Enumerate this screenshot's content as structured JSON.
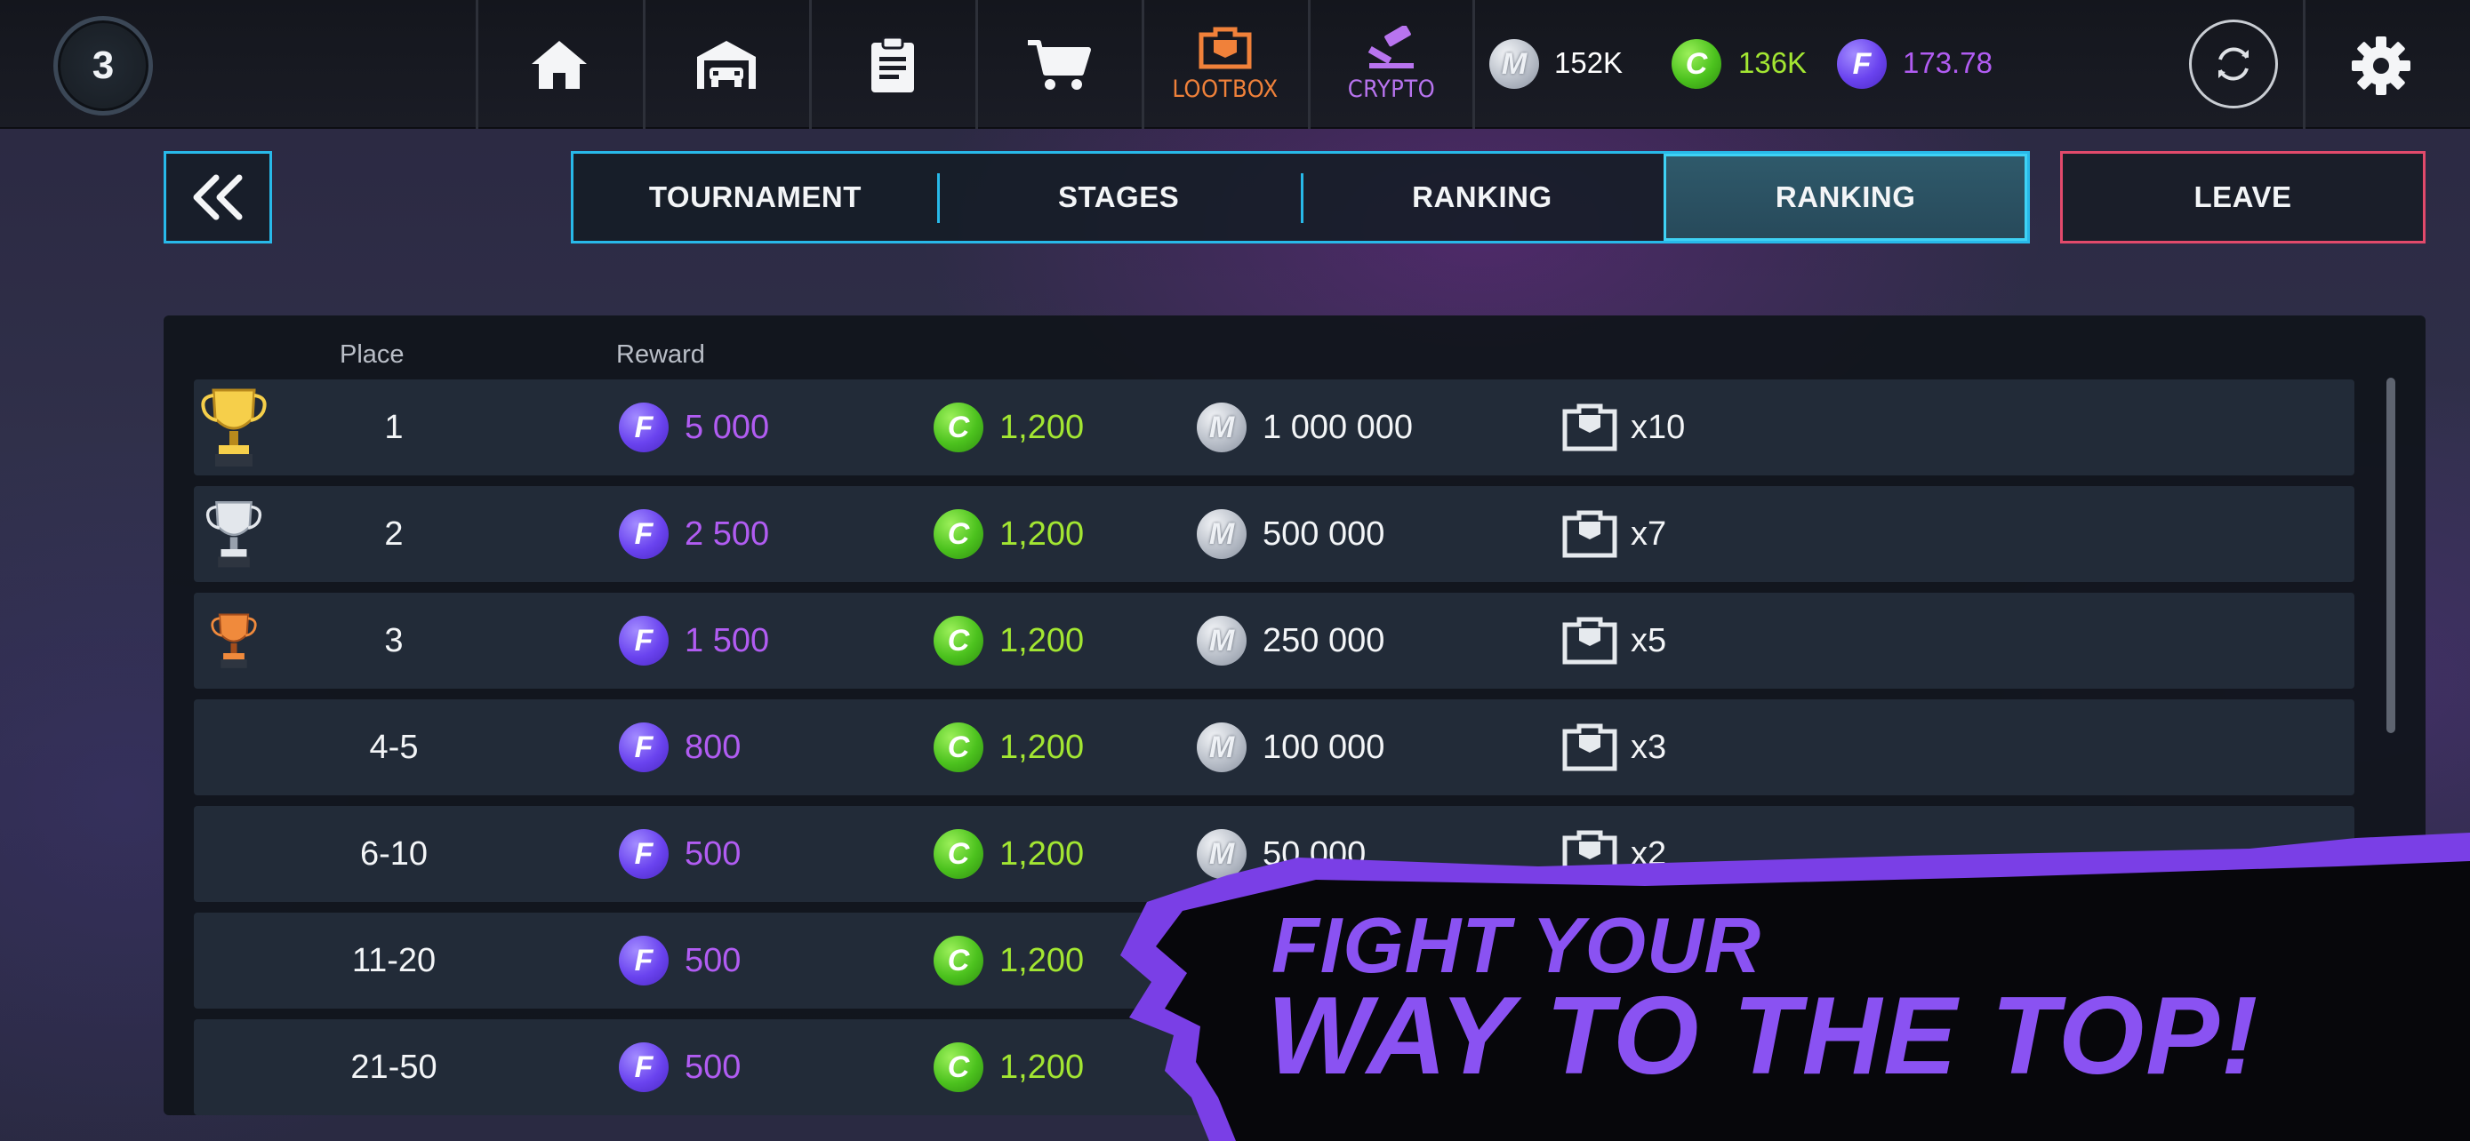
{
  "topbar": {
    "level": "3",
    "nav": [
      {
        "name": "home",
        "label": ""
      },
      {
        "name": "garage",
        "label": ""
      },
      {
        "name": "tasks",
        "label": ""
      },
      {
        "name": "shop",
        "label": ""
      },
      {
        "name": "lootbox",
        "label": "LOOTBOX"
      },
      {
        "name": "crypto",
        "label": "CRYPTO"
      }
    ],
    "currencies": {
      "m": {
        "symbol": "M",
        "value": "152K",
        "color": "#ffffff"
      },
      "c": {
        "symbol": "C",
        "value": "136K",
        "color": "#a3e632"
      },
      "f": {
        "symbol": "F",
        "value": "173.78",
        "color": "#b15cf2"
      }
    }
  },
  "tabs": {
    "items": [
      "TOURNAMENT",
      "STAGES",
      "RANKING",
      "RANKING"
    ],
    "active_index": 3,
    "leave_label": "LEAVE"
  },
  "table": {
    "headers": {
      "place": "Place",
      "reward": "Reward"
    },
    "rows": [
      {
        "place": "1",
        "trophy": "gold",
        "f": "5 000",
        "c": "1,200",
        "m": "1 000 000",
        "lootbox": "x10"
      },
      {
        "place": "2",
        "trophy": "silver",
        "f": "2 500",
        "c": "1,200",
        "m": "500 000",
        "lootbox": "x7"
      },
      {
        "place": "3",
        "trophy": "bronze",
        "f": "1 500",
        "c": "1,200",
        "m": "250 000",
        "lootbox": "x5"
      },
      {
        "place": "4-5",
        "trophy": "",
        "f": "800",
        "c": "1,200",
        "m": "100 000",
        "lootbox": "x3"
      },
      {
        "place": "6-10",
        "trophy": "",
        "f": "500",
        "c": "1,200",
        "m": "50 000",
        "lootbox": "x2"
      },
      {
        "place": "11-20",
        "trophy": "",
        "f": "500",
        "c": "1,200",
        "m": "",
        "lootbox": ""
      },
      {
        "place": "21-50",
        "trophy": "",
        "f": "500",
        "c": "1,200",
        "m": "",
        "lootbox": ""
      }
    ],
    "coin_symbols": {
      "f": "F",
      "c": "C",
      "m": "M"
    }
  },
  "promo": {
    "line1": "FIGHT YOUR",
    "line2": "WAY TO THE TOP!"
  },
  "colors": {
    "accent_cyan": "#28b9e9",
    "leave_border": "#e24a6b",
    "lootbox_orange": "#f0813a",
    "crypto_purple": "#b874ef",
    "promo_purple": "#8a52f2"
  }
}
